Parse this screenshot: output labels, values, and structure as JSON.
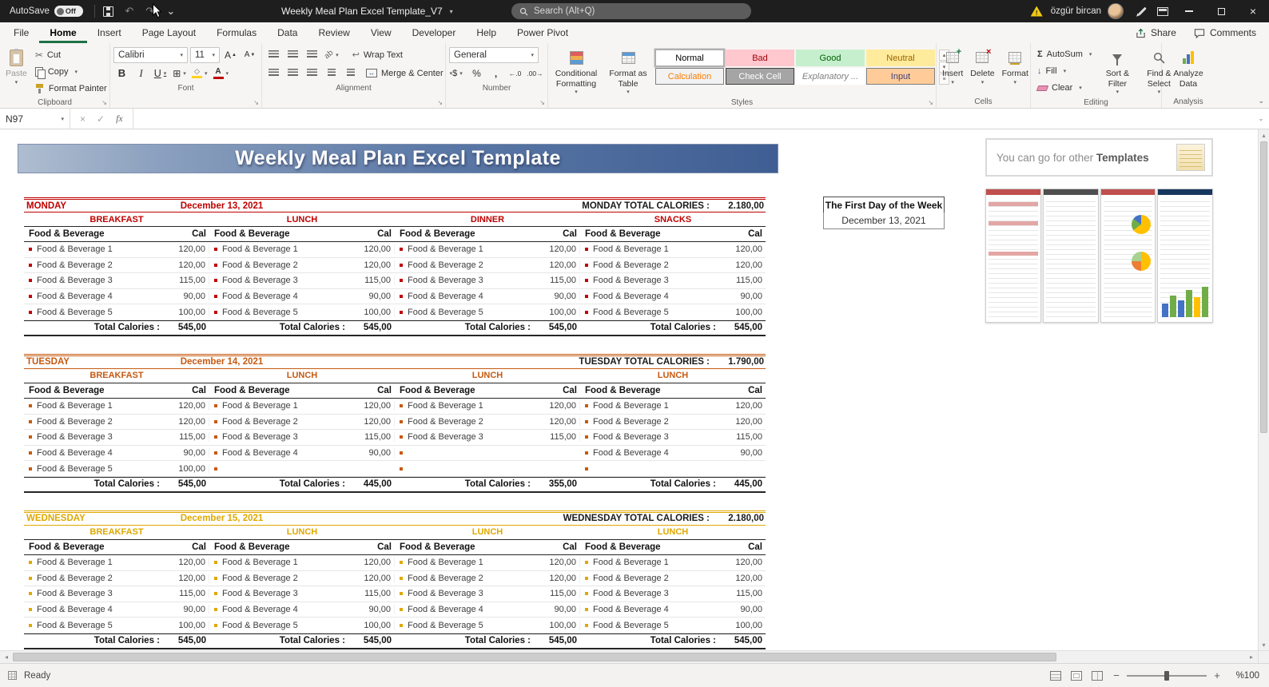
{
  "titlebar": {
    "autosave_label": "AutoSave",
    "autosave_state": "Off",
    "doc_title": "Weekly Meal Plan Excel Template_V7",
    "search_placeholder": "Search (Alt+Q)",
    "user_name": "özgür bircan"
  },
  "tabs": {
    "items": [
      "File",
      "Home",
      "Insert",
      "Page Layout",
      "Formulas",
      "Data",
      "Review",
      "View",
      "Developer",
      "Help",
      "Power Pivot"
    ],
    "active": "Home",
    "share": "Share",
    "comments": "Comments"
  },
  "ribbon": {
    "clipboard": {
      "group": "Clipboard",
      "paste": "Paste",
      "cut": "Cut",
      "copy": "Copy",
      "format_painter": "Format Painter"
    },
    "font": {
      "group": "Font",
      "name": "Calibri",
      "size": "11"
    },
    "alignment": {
      "group": "Alignment",
      "wrap": "Wrap Text",
      "merge": "Merge & Center"
    },
    "number": {
      "group": "Number",
      "format": "General"
    },
    "styles": {
      "group": "Styles",
      "conditional": "Conditional Formatting",
      "format_table": "Format as Table",
      "gallery": [
        {
          "label": "Normal",
          "bg": "#FFFFFF",
          "fg": "#000000",
          "border": "#ACACAC",
          "selected": true
        },
        {
          "label": "Bad",
          "bg": "#FFC7CE",
          "fg": "#9C0006"
        },
        {
          "label": "Good",
          "bg": "#C6EFCE",
          "fg": "#006100"
        },
        {
          "label": "Neutral",
          "bg": "#FFEB9C",
          "fg": "#9C6500"
        },
        {
          "label": "Calculation",
          "bg": "#F2F2F2",
          "fg": "#FA7D00",
          "border": "#7F7F7F"
        },
        {
          "label": "Check Cell",
          "bg": "#A5A5A5",
          "fg": "#FFFFFF",
          "border": "#3F3F3F"
        },
        {
          "label": "Explanatory ...",
          "bg": "#FFFFFF",
          "fg": "#7F7F7F",
          "italic": true
        },
        {
          "label": "Input",
          "bg": "#FFCC99",
          "fg": "#3F3F76",
          "border": "#7F7F7F"
        }
      ]
    },
    "cells": {
      "group": "Cells",
      "insert": "Insert",
      "delete": "Delete",
      "format": "Format"
    },
    "editing": {
      "group": "Editing",
      "autosum": "AutoSum",
      "fill": "Fill",
      "clear": "Clear",
      "sort": "Sort & Filter",
      "find": "Find & Select"
    },
    "analysis": {
      "group": "Analysis",
      "analyze": "Analyze Data"
    }
  },
  "formula_bar": {
    "name_box": "N97",
    "fx": "fx"
  },
  "sheet": {
    "banner": "Weekly Meal Plan Excel Template",
    "promo": {
      "prefix": "You can go for other ",
      "bold": "Templates"
    },
    "first_day": {
      "label": "The First Day of the Week",
      "date": "December 13, 2021"
    },
    "food_header": "Food & Beverage",
    "cal_header": "Cal",
    "item_total_label": "Total Calories :",
    "thumbnails": [
      "template-thumbnail-1",
      "template-thumbnail-2",
      "template-thumbnail-3",
      "template-thumbnail-4"
    ],
    "days": [
      {
        "name": "MONDAY",
        "date": "December 13, 2021",
        "total_label": "MONDAY TOTAL CALORIES :",
        "total": "2.180,00",
        "color": "#C00000",
        "sections": [
          {
            "title": "BREAKFAST",
            "total": "545,00",
            "items": [
              [
                "Food & Beverage 1",
                "120,00"
              ],
              [
                "Food & Beverage 2",
                "120,00"
              ],
              [
                "Food & Beverage 3",
                "115,00"
              ],
              [
                "Food & Beverage 4",
                "90,00"
              ],
              [
                "Food & Beverage 5",
                "100,00"
              ]
            ]
          },
          {
            "title": "LUNCH",
            "total": "545,00",
            "items": [
              [
                "Food & Beverage 1",
                "120,00"
              ],
              [
                "Food & Beverage 2",
                "120,00"
              ],
              [
                "Food & Beverage 3",
                "115,00"
              ],
              [
                "Food & Beverage 4",
                "90,00"
              ],
              [
                "Food & Beverage 5",
                "100,00"
              ]
            ]
          },
          {
            "title": "DINNER",
            "total": "545,00",
            "items": [
              [
                "Food & Beverage 1",
                "120,00"
              ],
              [
                "Food & Beverage 2",
                "120,00"
              ],
              [
                "Food & Beverage 3",
                "115,00"
              ],
              [
                "Food & Beverage 4",
                "90,00"
              ],
              [
                "Food & Beverage 5",
                "100,00"
              ]
            ]
          },
          {
            "title": "SNACKS",
            "total": "545,00",
            "items": [
              [
                "Food & Beverage 1",
                "120,00"
              ],
              [
                "Food & Beverage 2",
                "120,00"
              ],
              [
                "Food & Beverage 3",
                "115,00"
              ],
              [
                "Food & Beverage 4",
                "90,00"
              ],
              [
                "Food & Beverage 5",
                "100,00"
              ]
            ]
          }
        ]
      },
      {
        "name": "TUESDAY",
        "date": "December 14, 2021",
        "total_label": "TUESDAY TOTAL CALORIES :",
        "total": "1.790,00",
        "color": "#C55A11",
        "sections": [
          {
            "title": "BREAKFAST",
            "total": "545,00",
            "items": [
              [
                "Food & Beverage 1",
                "120,00"
              ],
              [
                "Food & Beverage 2",
                "120,00"
              ],
              [
                "Food & Beverage 3",
                "115,00"
              ],
              [
                "Food & Beverage 4",
                "90,00"
              ],
              [
                "Food & Beverage 5",
                "100,00"
              ]
            ]
          },
          {
            "title": "LUNCH",
            "total": "445,00",
            "items": [
              [
                "Food & Beverage 1",
                "120,00"
              ],
              [
                "Food & Beverage 2",
                "120,00"
              ],
              [
                "Food & Beverage 3",
                "115,00"
              ],
              [
                "Food & Beverage 4",
                "90,00"
              ],
              [
                "",
                ""
              ]
            ]
          },
          {
            "title": "LUNCH",
            "total": "355,00",
            "items": [
              [
                "Food & Beverage 1",
                "120,00"
              ],
              [
                "Food & Beverage 2",
                "120,00"
              ],
              [
                "Food & Beverage 3",
                "115,00"
              ],
              [
                "",
                ""
              ],
              [
                "",
                ""
              ]
            ]
          },
          {
            "title": "LUNCH",
            "total": "445,00",
            "items": [
              [
                "Food & Beverage 1",
                "120,00"
              ],
              [
                "Food & Beverage 2",
                "120,00"
              ],
              [
                "Food & Beverage 3",
                "115,00"
              ],
              [
                "Food & Beverage 4",
                "90,00"
              ],
              [
                "",
                ""
              ]
            ]
          }
        ]
      },
      {
        "name": "WEDNESDAY",
        "date": "December 15, 2021",
        "total_label": "WEDNESDAY TOTAL CALORIES :",
        "total": "2.180,00",
        "color": "#DFA800",
        "sections": [
          {
            "title": "BREAKFAST",
            "total": "545,00",
            "items": [
              [
                "Food & Beverage 1",
                "120,00"
              ],
              [
                "Food & Beverage 2",
                "120,00"
              ],
              [
                "Food & Beverage 3",
                "115,00"
              ],
              [
                "Food & Beverage 4",
                "90,00"
              ],
              [
                "Food & Beverage 5",
                "100,00"
              ]
            ]
          },
          {
            "title": "LUNCH",
            "total": "545,00",
            "items": [
              [
                "Food & Beverage 1",
                "120,00"
              ],
              [
                "Food & Beverage 2",
                "120,00"
              ],
              [
                "Food & Beverage 3",
                "115,00"
              ],
              [
                "Food & Beverage 4",
                "90,00"
              ],
              [
                "Food & Beverage 5",
                "100,00"
              ]
            ]
          },
          {
            "title": "LUNCH",
            "total": "545,00",
            "items": [
              [
                "Food & Beverage 1",
                "120,00"
              ],
              [
                "Food & Beverage 2",
                "120,00"
              ],
              [
                "Food & Beverage 3",
                "115,00"
              ],
              [
                "Food & Beverage 4",
                "90,00"
              ],
              [
                "Food & Beverage 5",
                "100,00"
              ]
            ]
          },
          {
            "title": "LUNCH",
            "total": "545,00",
            "items": [
              [
                "Food & Beverage 1",
                "120,00"
              ],
              [
                "Food & Beverage 2",
                "120,00"
              ],
              [
                "Food & Beverage 3",
                "115,00"
              ],
              [
                "Food & Beverage 4",
                "90,00"
              ],
              [
                "Food & Beverage 5",
                "100,00"
              ]
            ]
          }
        ]
      }
    ]
  },
  "status_bar": {
    "ready": "Ready",
    "zoom": "%100"
  }
}
